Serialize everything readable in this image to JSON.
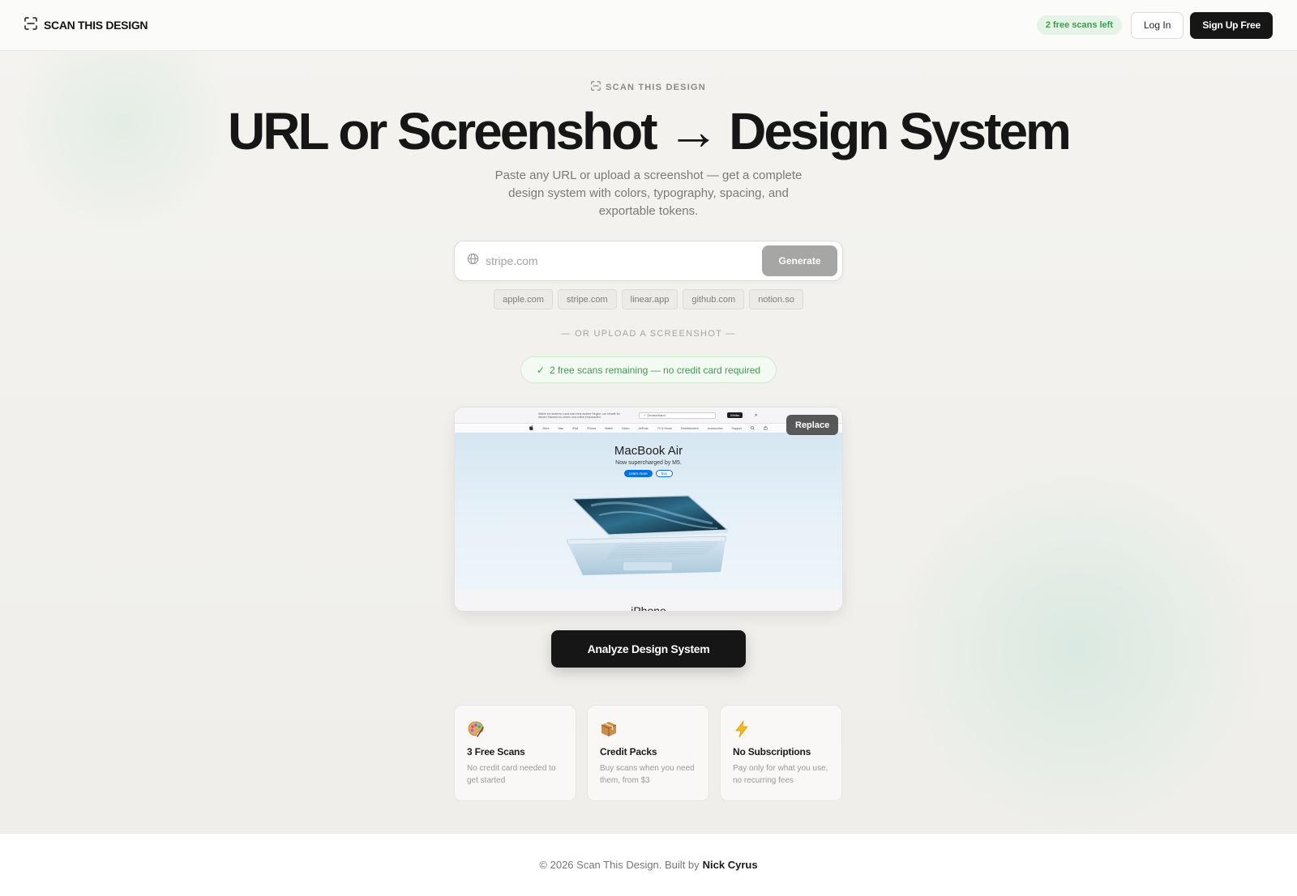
{
  "header": {
    "brand_name": "SCAN THIS DESIGN",
    "scans_badge": "2 free scans left",
    "login_label": "Log In",
    "signup_label": "Sign Up Free"
  },
  "hero": {
    "eyebrow": "SCAN THIS DESIGN",
    "title": "URL or Screenshot → Design System",
    "subtitle": "Paste any URL or upload a screenshot — get a complete design system with colors, typography, spacing, and exportable tokens."
  },
  "url_form": {
    "placeholder": "stripe.com",
    "generate_label": "Generate",
    "suggestions": [
      "apple.com",
      "stripe.com",
      "linear.app",
      "github.com",
      "notion.so"
    ]
  },
  "upload": {
    "divider": "— OR UPLOAD A SCREENSHOT —",
    "remaining_check": "✓",
    "remaining_text": "2 free scans remaining — no credit card required",
    "replace_label": "Replace",
    "analyze_label": "Analyze Design System"
  },
  "preview": {
    "banner_text": "Wähle ein anderes Land oder eine andere Region, um Inhalte für deinen Standort zu sehen und online einzukaufen.",
    "country": "✓ Deutschland",
    "continue": "Weiter",
    "close": "✕",
    "nav": [
      "Store",
      "Mac",
      "iPad",
      "iPhone",
      "Watch",
      "Vision",
      "AirPods",
      "TV & Home",
      "Entertainment",
      "Accessories",
      "Support"
    ],
    "title": "MacBook Air",
    "tagline": "Now supercharged by M5.",
    "learn_more": "Learn more",
    "buy": "Buy",
    "next_section": "iPhone"
  },
  "features": [
    {
      "icon": "palette-icon",
      "emoji": "🎨",
      "title": "3 Free Scans",
      "desc": "No credit card needed to get started"
    },
    {
      "icon": "package-icon",
      "emoji": "📦",
      "title": "Credit Packs",
      "desc": "Buy scans when you need them, from $3"
    },
    {
      "icon": "lightning-icon",
      "emoji": "⚡",
      "title": "No Subscriptions",
      "desc": "Pay only for what you use, no recurring fees"
    }
  ],
  "footer": {
    "copyright": "© 2026 Scan This Design. Built by",
    "author": "Nick Cyrus"
  },
  "colors": {
    "ink": "#161616",
    "success": "#3f9a52",
    "success_bg": "#e5f4e6",
    "apple_blue": "#0071e3"
  }
}
